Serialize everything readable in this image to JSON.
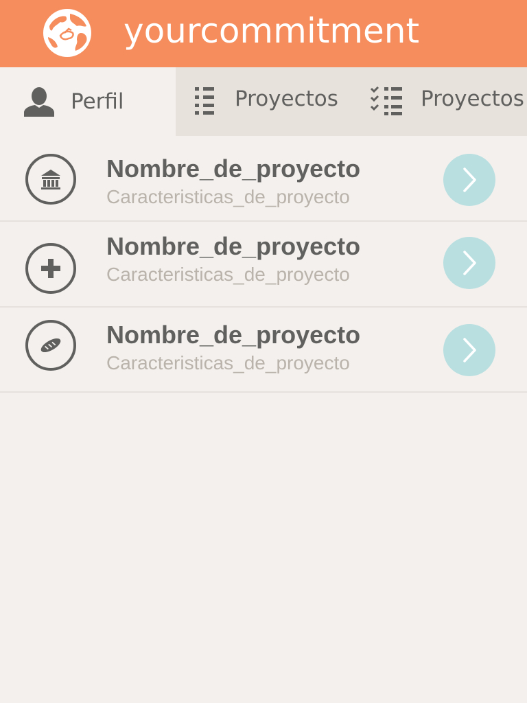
{
  "header": {
    "title": "yourcommitment",
    "logo_icon": "globe-handshake-logo",
    "background_color": "#f58d5c"
  },
  "tabs": [
    {
      "label": "Perfil",
      "icon": "user-icon",
      "active": true
    },
    {
      "label": "Proyectos",
      "icon": "list-icon",
      "active": false
    },
    {
      "label": "Proyectos",
      "icon": "checklist-icon",
      "active": false
    }
  ],
  "projects": [
    {
      "name": "Nombre_de_proyecto",
      "details": "Caracteristicas_de_proyecto",
      "icon": "bank-icon"
    },
    {
      "name": "Nombre_de_proyecto",
      "details": "Caracteristicas_de_proyecto",
      "icon": "plus-icon"
    },
    {
      "name": "Nombre_de_proyecto",
      "details": "Caracteristicas_de_proyecto",
      "icon": "bread-icon"
    }
  ],
  "colors": {
    "accent": "#f58d5c",
    "arrow_button": "#b9dfe1",
    "title_text": "#60605e",
    "subtitle_text": "#b9b3ab",
    "background": "#f3f0ed",
    "tab_inactive": "#e8e2dd"
  }
}
